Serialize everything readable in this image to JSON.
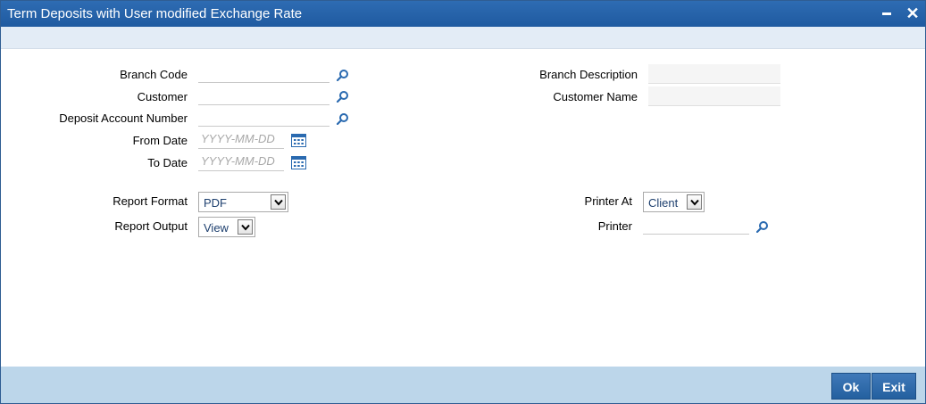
{
  "window": {
    "title": "Term Deposits with User modified Exchange Rate",
    "minimize_glyph": "−",
    "close_glyph": "✕"
  },
  "form": {
    "branch_code": {
      "label": "Branch Code",
      "value": ""
    },
    "customer": {
      "label": "Customer",
      "value": ""
    },
    "deposit_account_number": {
      "label": "Deposit Account Number",
      "value": ""
    },
    "from_date": {
      "label": "From Date",
      "placeholder": "YYYY-MM-DD",
      "value": ""
    },
    "to_date": {
      "label": "To Date",
      "placeholder": "YYYY-MM-DD",
      "value": ""
    },
    "branch_description": {
      "label": "Branch Description",
      "value": ""
    },
    "customer_name": {
      "label": "Customer Name",
      "value": ""
    },
    "report_format": {
      "label": "Report Format",
      "selected": "PDF"
    },
    "report_output": {
      "label": "Report Output",
      "selected": "View"
    },
    "printer_at": {
      "label": "Printer At",
      "selected": "Client"
    },
    "printer": {
      "label": "Printer",
      "value": ""
    }
  },
  "footer": {
    "ok_label": "Ok",
    "exit_label": "Exit"
  },
  "colors": {
    "titlebar": "#2665ab",
    "footer": "#bcd6ea",
    "button": "#2e6aad",
    "icon": "#2a6ab0"
  }
}
